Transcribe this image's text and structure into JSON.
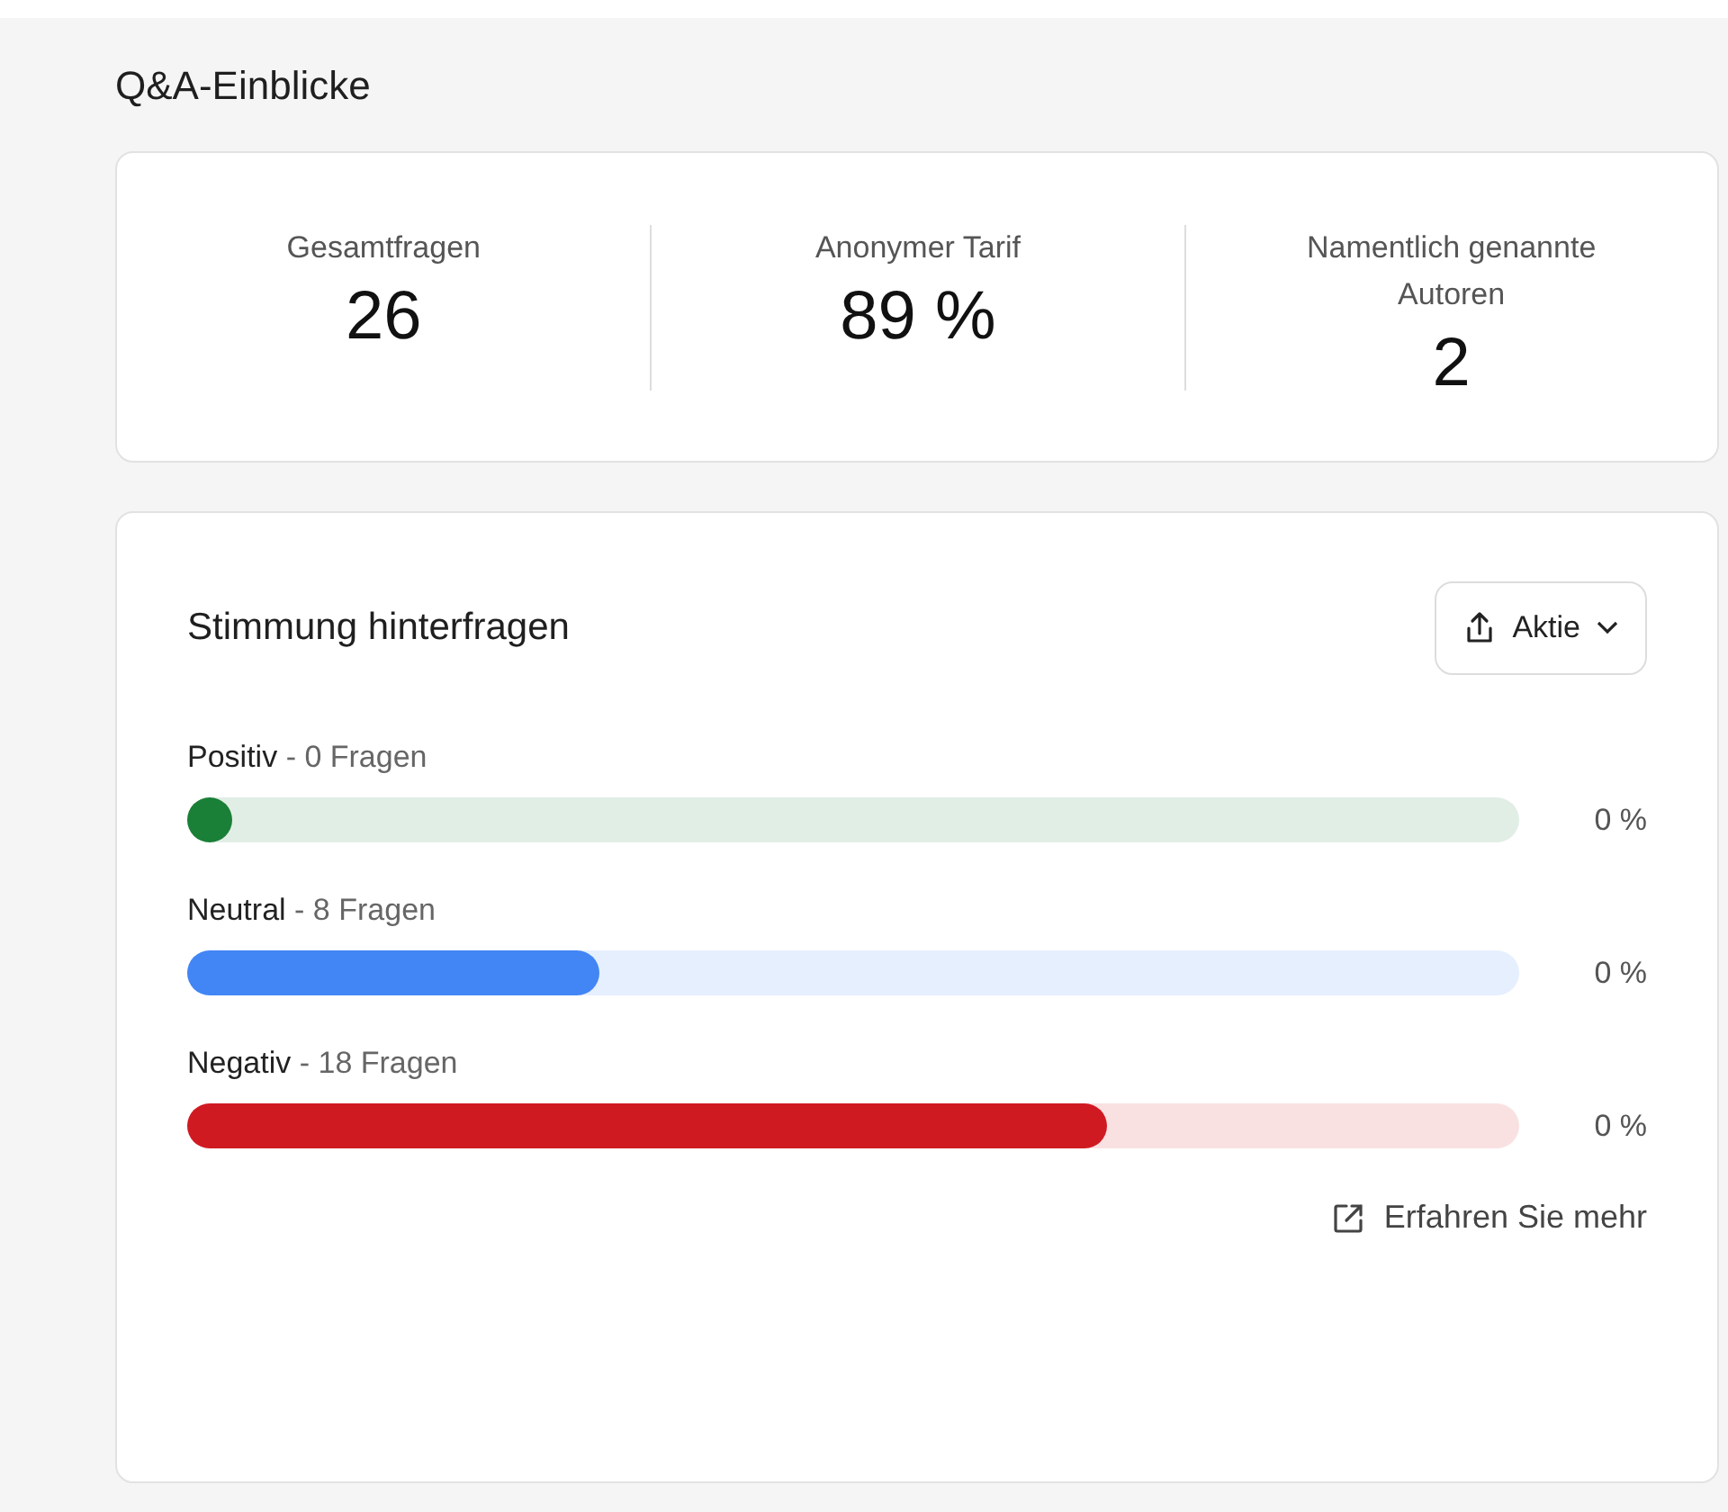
{
  "title": "Q&A-Einblicke",
  "stats": [
    {
      "label": "Gesamtfragen",
      "value": "26"
    },
    {
      "label": "Anonymer Tarif",
      "value": "89 %"
    },
    {
      "label": "Namentlich genannte Autoren",
      "value": "2"
    }
  ],
  "sentiment": {
    "title": "Stimmung hinterfragen",
    "share_button": "Aktie",
    "bars": [
      {
        "name": "Positiv",
        "count": "- 0 Fragen",
        "level": 0,
        "color": "#1a7f37",
        "reading": "0 %"
      },
      {
        "name": "Neutral",
        "count": "- 8 Fragen",
        "level": 0.31,
        "color": "#4285f4",
        "reading": "0 %"
      },
      {
        "name": "Negativ",
        "count": "- 18 Fragen",
        "level": 0.69,
        "color": "#d01a22",
        "reading": "0 %"
      }
    ],
    "link": "Erfahren Sie mehr"
  }
}
